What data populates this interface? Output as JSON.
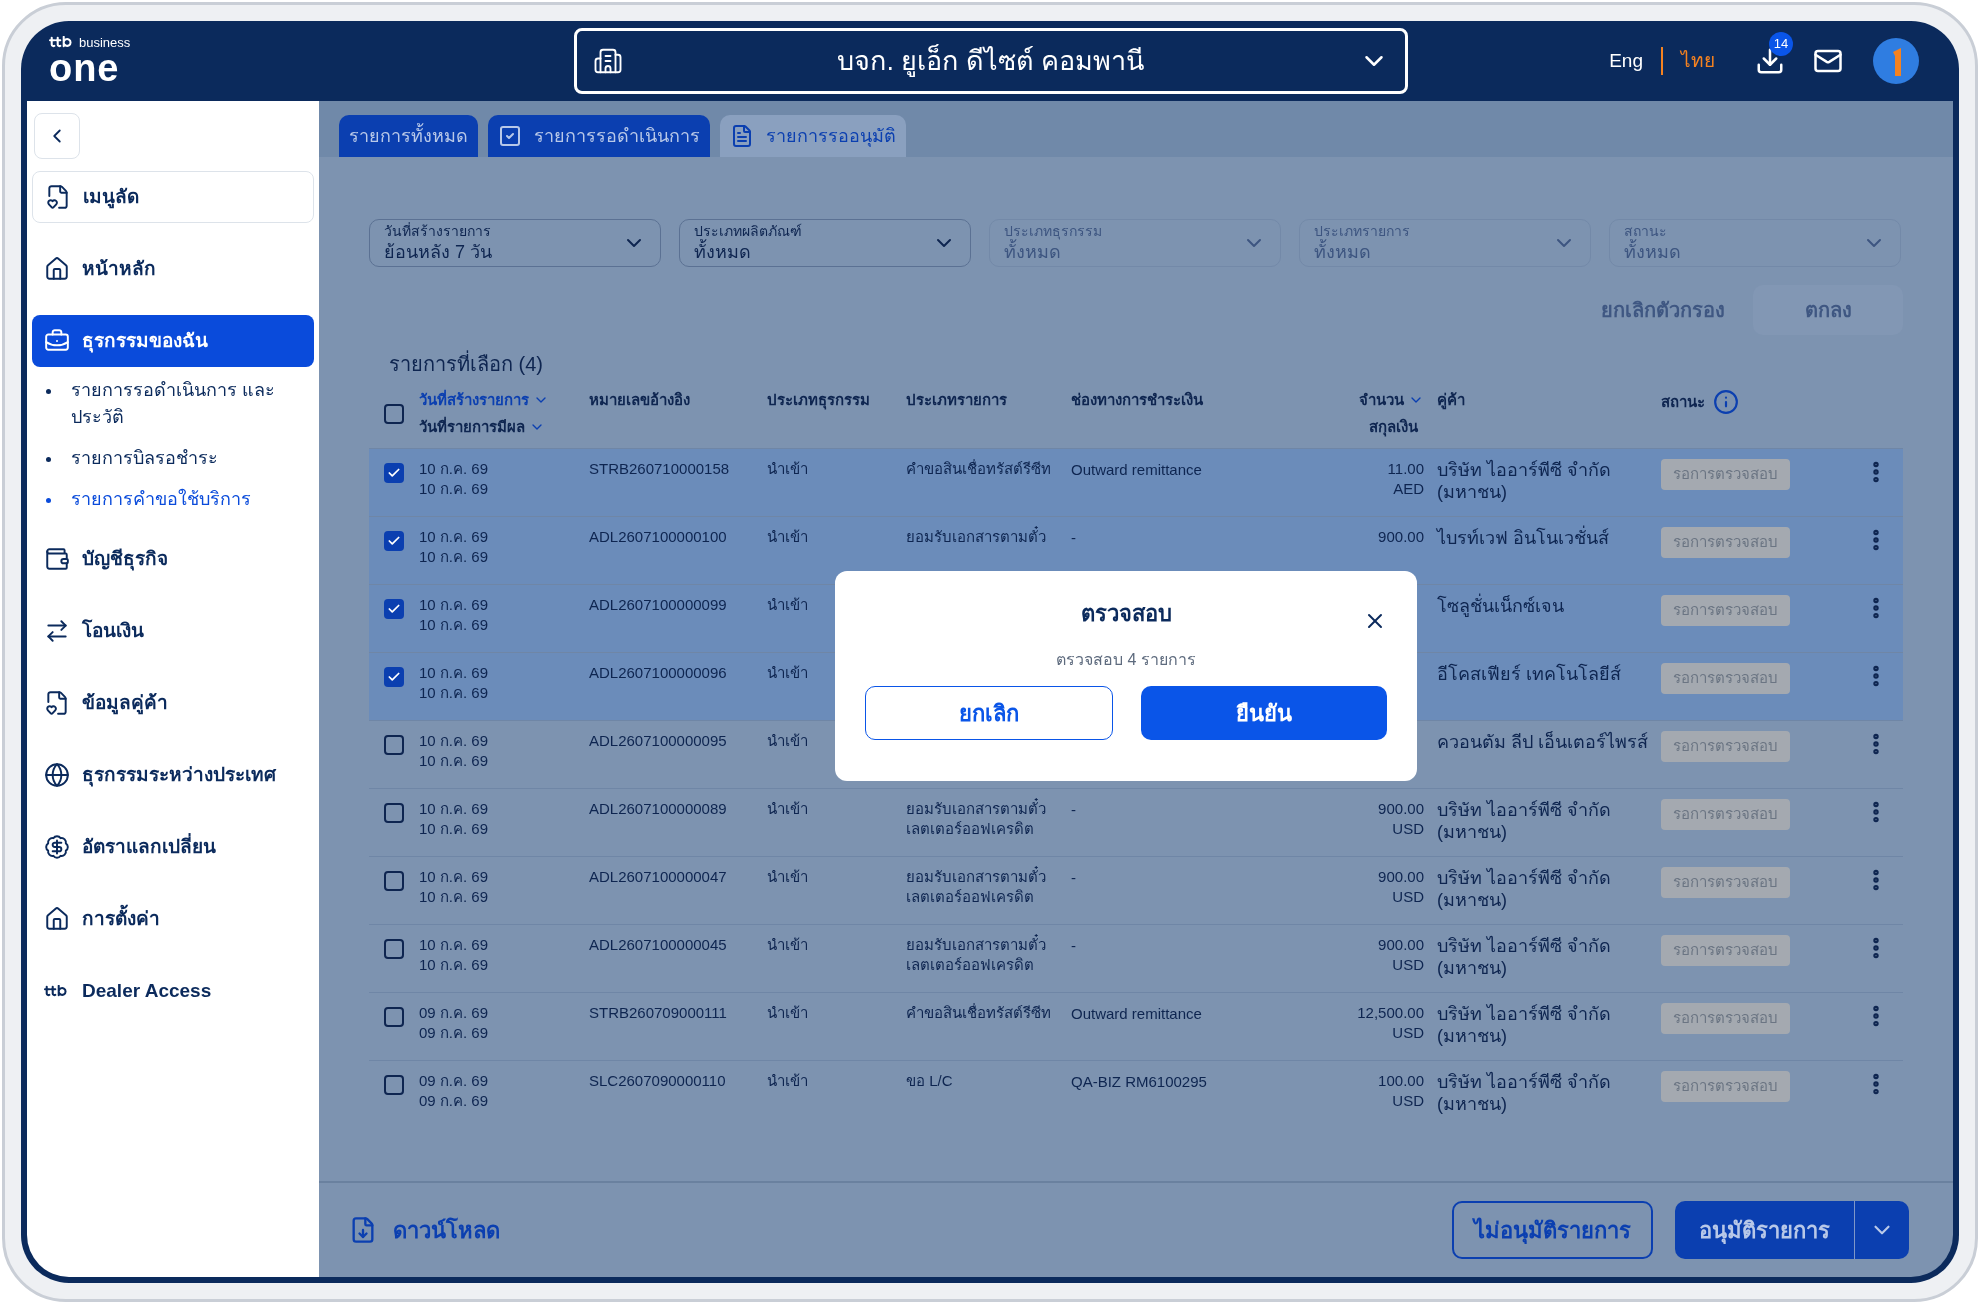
{
  "header": {
    "brand_small": "business",
    "brand": "one",
    "company": "บจก. ยูเอ็ก ดีไซต์ คอมพานี",
    "languages": [
      {
        "label": "Eng",
        "selected": false
      },
      {
        "label": "ไทย",
        "selected": true
      }
    ],
    "download_badge": "14"
  },
  "sidebar": {
    "items": [
      {
        "label": "เมนูลัด",
        "kind": "shortcut",
        "selected": false
      },
      {
        "label": "หน้าหลัก",
        "kind": "link",
        "selected": false
      },
      {
        "label": "ธุรกรรมของฉัน",
        "kind": "link",
        "selected": true,
        "children": [
          {
            "label": "รายการรอดำเนินการ และประวัติ",
            "selected": false
          },
          {
            "label": "รายการบิลรอชำระ",
            "selected": false
          },
          {
            "label": "รายการคำขอใช้บริการ",
            "selected": true
          }
        ]
      },
      {
        "label": "บัญชีธุรกิจ",
        "kind": "link",
        "selected": false
      },
      {
        "label": "โอนเงิน",
        "kind": "link",
        "selected": false
      },
      {
        "label": "ข้อมูลคู่ค้า",
        "kind": "link",
        "selected": false
      },
      {
        "label": "ธุรกรรมระหว่างประเทศ",
        "kind": "link",
        "selected": false
      },
      {
        "label": "อัตราแลกเปลี่ยน",
        "kind": "link",
        "selected": false
      },
      {
        "label": "การตั้งค่า",
        "kind": "link",
        "selected": false
      },
      {
        "label": "Dealer Access",
        "kind": "link",
        "selected": false
      }
    ]
  },
  "tabs": [
    {
      "label": "รายการทั้งหมด",
      "selected": false
    },
    {
      "label": "รายการรอดำเนินการ",
      "selected": false
    },
    {
      "label": "รายการรออนุมัติ",
      "selected": true
    }
  ],
  "filters": [
    {
      "label": "วันที่สร้างรายการ",
      "value": "ย้อนหลัง 7 วัน",
      "disabled": false
    },
    {
      "label": "ประเภทผลิตภัณฑ์",
      "value": "ทั้งหมด",
      "disabled": false
    },
    {
      "label": "ประเภทธุรกรรม",
      "value": "ทั้งหมด",
      "disabled": true
    },
    {
      "label": "ประเภทรายการ",
      "value": "ทั้งหมด",
      "disabled": true
    },
    {
      "label": "สถานะ",
      "value": "ทั้งหมด",
      "disabled": true
    }
  ],
  "filter_actions": {
    "clear": "ยกเลิกตัวกรอง",
    "apply": "ตกลง"
  },
  "selection_title": "รายการที่เลือก (4)",
  "table": {
    "all_checked": false,
    "columns": {
      "created": "วันที่สร้างรายการ",
      "effective": "วันที่รายการมีผล",
      "reference": "หมายเลขอ้างอิง",
      "business_type": "ประเภทธุรกรรม",
      "transaction_type": "ประเภทรายการ",
      "channel": "ช่องทางการชำระเงิน",
      "amount": "จำนวน",
      "currency": "สกุลเงิน",
      "partner": "คู่ค้า",
      "status": "สถานะ"
    },
    "rows": [
      {
        "checked": true,
        "created": "10 ก.ค. 69",
        "effective": "10 ก.ค. 69",
        "reference": "STRB260710000158",
        "business_type": "นำเข้า",
        "transaction_type": "คำขอสินเชื่อทรัสต์รีซีท",
        "channel": "Outward remittance",
        "amount": "11.00",
        "currency": "AED",
        "partner": "บริษัท ไออาร์พีซี จำกัด (มหาชน)",
        "status": "รอการตรวจสอบ"
      },
      {
        "checked": true,
        "created": "10 ก.ค. 69",
        "effective": "10 ก.ค. 69",
        "reference": "ADL2607100000100",
        "business_type": "นำเข้า",
        "transaction_type": "ยอมรับเอกสารตามตั๋ว",
        "channel": "-",
        "amount": "900.00",
        "partner": "ไบรท์เวฟ อินโนเวชั่นส์",
        "status": "รอการตรวจสอบ"
      },
      {
        "checked": true,
        "created": "10 ก.ค. 69",
        "effective": "10 ก.ค. 69",
        "reference": "ADL2607100000099",
        "business_type": "นำเข้า",
        "partner": "โซลูชั่นเน็กซ์เจน",
        "status": "รอการตรวจสอบ"
      },
      {
        "checked": true,
        "created": "10 ก.ค. 69",
        "effective": "10 ก.ค. 69",
        "reference": "ADL2607100000096",
        "business_type": "นำเข้า",
        "partner": "อีโคสเฟียร์ เทคโนโลยีส์",
        "status": "รอการตรวจสอบ"
      },
      {
        "checked": false,
        "created": "10 ก.ค. 69",
        "effective": "10 ก.ค. 69",
        "reference": "ADL2607100000095",
        "business_type": "นำเข้า",
        "partner": "ควอนตัม ลีป เอ็นเตอร์ไพรส์",
        "status": "รอการตรวจสอบ"
      },
      {
        "checked": false,
        "created": "10 ก.ค. 69",
        "effective": "10 ก.ค. 69",
        "reference": "ADL2607100000089",
        "business_type": "นำเข้า",
        "transaction_type": "ยอมรับเอกสารตามตั๋ว เลตเตอร์ออฟเครดิต",
        "channel": "-",
        "amount": "900.00",
        "currency": "USD",
        "partner": "บริษัท ไออาร์พีซี จำกัด (มหาชน)",
        "status": "รอการตรวจสอบ"
      },
      {
        "checked": false,
        "created": "10 ก.ค. 69",
        "effective": "10 ก.ค. 69",
        "reference": "ADL2607100000047",
        "business_type": "นำเข้า",
        "transaction_type": "ยอมรับเอกสารตามตั๋ว เลตเตอร์ออฟเครดิต",
        "channel": "-",
        "amount": "900.00",
        "currency": "USD",
        "partner": "บริษัท ไออาร์พีซี จำกัด (มหาชน)",
        "status": "รอการตรวจสอบ"
      },
      {
        "checked": false,
        "created": "10 ก.ค. 69",
        "effective": "10 ก.ค. 69",
        "reference": "ADL2607100000045",
        "business_type": "นำเข้า",
        "transaction_type": "ยอมรับเอกสารตามตั๋ว เลตเตอร์ออฟเครดิต",
        "channel": "-",
        "amount": "900.00",
        "currency": "USD",
        "partner": "บริษัท ไออาร์พีซี จำกัด (มหาชน)",
        "status": "รอการตรวจสอบ"
      },
      {
        "checked": false,
        "created": "09 ก.ค. 69",
        "effective": "09 ก.ค. 69",
        "reference": "STRB260709000111",
        "business_type": "นำเข้า",
        "transaction_type": "คำขอสินเชื่อทรัสต์รีซีท",
        "channel": "Outward remittance",
        "amount": "12,500.00",
        "currency": "USD",
        "partner": "บริษัท ไออาร์พีซี จำกัด (มหาชน)",
        "status": "รอการตรวจสอบ"
      },
      {
        "checked": false,
        "created": "09 ก.ค. 69",
        "effective": "09 ก.ค. 69",
        "reference": "SLC2607090000110",
        "business_type": "นำเข้า",
        "transaction_type": "ขอ L/C",
        "channel": "QA-BIZ RM6100295",
        "amount": "100.00",
        "currency": "USD",
        "partner": "บริษัท ไออาร์พีซี จำกัด (มหาชน)",
        "status": "รอการตรวจสอบ"
      }
    ]
  },
  "footer": {
    "download": "ดาวน์โหลด",
    "reject": "ไม่อนุมัติรายการ",
    "approve": "อนุมัติรายการ"
  },
  "dialog": {
    "title": "ตรวจสอบ",
    "message": "ตรวจสอบ 4 รายการ",
    "cancel": "ยกเลิก",
    "confirm": "ยืนยัน"
  }
}
